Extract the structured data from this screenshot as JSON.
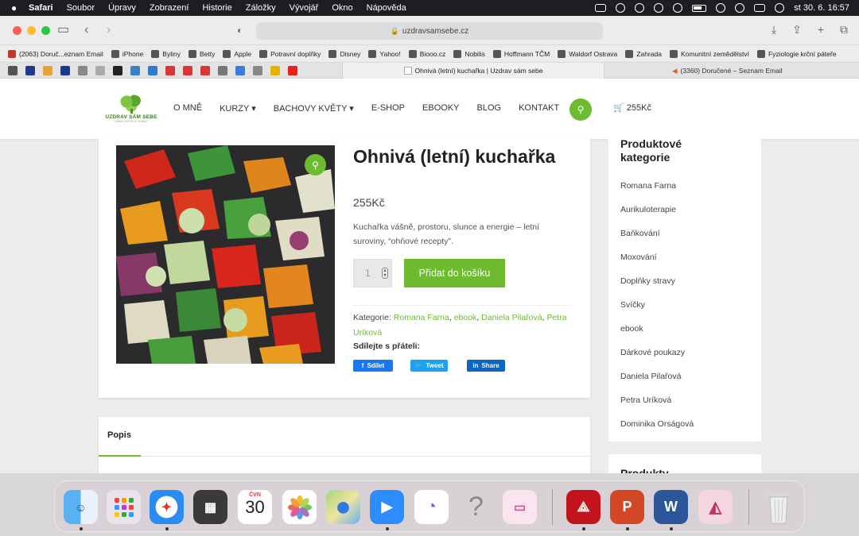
{
  "menubar": {
    "app": "Safari",
    "items": [
      "Soubor",
      "Úpravy",
      "Zobrazení",
      "Historie",
      "Záložky",
      "Vývojář",
      "Okno",
      "Nápověda"
    ],
    "clock": "st 30. 6.  16:57"
  },
  "browser": {
    "url": "uzdravsamsebe.cz",
    "bookmarks": [
      {
        "label": "(2063) Doruč...eznam Email",
        "color": "#c0392b"
      },
      {
        "label": "iPhone",
        "color": "#555"
      },
      {
        "label": "Byliny",
        "color": "#555"
      },
      {
        "label": "Betty",
        "color": "#555"
      },
      {
        "label": "Apple",
        "color": "#555"
      },
      {
        "label": "Potravní doplňky",
        "color": "#555"
      },
      {
        "label": "Disney",
        "color": "#555"
      },
      {
        "label": "Yahoo!",
        "color": "#555"
      },
      {
        "label": "Biooo.cz",
        "color": "#555"
      },
      {
        "label": "Nobilis",
        "color": "#555"
      },
      {
        "label": "Hoffmann TČM",
        "color": "#555"
      },
      {
        "label": "Waldorf Ostrava",
        "color": "#555"
      },
      {
        "label": "Zahrada",
        "color": "#555"
      },
      {
        "label": "Komunitní zemědělství",
        "color": "#555"
      },
      {
        "label": "Fyziologie krční páteře",
        "color": "#555"
      }
    ],
    "active_tab": "Ohnivá (letní) kuchařka | Uzdrav sám sebe",
    "other_tab": "(3360) Doručené – Seznam Email"
  },
  "site": {
    "logo_text": "UZDRAV SÁM SEBE",
    "logo_sub": "SAMA CESTA KE ZDRAVÍ",
    "nav": [
      "O MNĚ",
      "KURZY ▾",
      "BACHOVY KVĚTY ▾",
      "E-SHOP",
      "EBOOKY",
      "BLOG",
      "KONTAKT"
    ],
    "cart": "255Kč"
  },
  "product": {
    "title": "Ohnivá (letní) kuchařka",
    "price": "255Kč",
    "description": "Kuchařka vášně, prostoru, slunce a energie – letní suroviny, “ohňové recepty”.",
    "quantity": "1",
    "add_to_cart": "Přidat do košíku",
    "categories_label": "Kategorie:",
    "categories": [
      "Romana Farna",
      "ebook",
      "Daniela Pilařová",
      "Petra Uríková"
    ],
    "share_label": "Sdílejte s přáteli:",
    "share_buttons": {
      "facebook": "Sdílet",
      "twitter": "Tweet",
      "linkedin": "Share"
    },
    "description_tab": "Popis"
  },
  "sidebar": {
    "title": "Produktové kategorie",
    "categories": [
      "Romana Farna",
      "Aurikuloterapie",
      "Baňkování",
      "Moxování",
      "Doplňky stravy",
      "Svíčky",
      "ebook",
      "Dárkové poukazy",
      "Daniela Pilařová",
      "Petra Uríková",
      "Dominika Orságová"
    ],
    "next_title": "Produkty"
  },
  "dock": {
    "calendar_month": "ČVN",
    "calendar_day": "30",
    "apps": [
      "finder-icon",
      "launchpad-icon",
      "safari-icon",
      "calculator-icon",
      "calendar-icon",
      "photos-icon",
      "maps-icon",
      "zoom-icon",
      "messenger-icon",
      "unknown-app-icon",
      "monitor-app-icon",
      "acrobat-icon",
      "powerpoint-icon",
      "word-icon",
      "affinity-icon",
      "trash-icon"
    ]
  },
  "colors": {
    "accent": "#6dbb2e",
    "facebook": "#1877f2",
    "twitter": "#1da1f2",
    "linkedin": "#0a66c2"
  }
}
